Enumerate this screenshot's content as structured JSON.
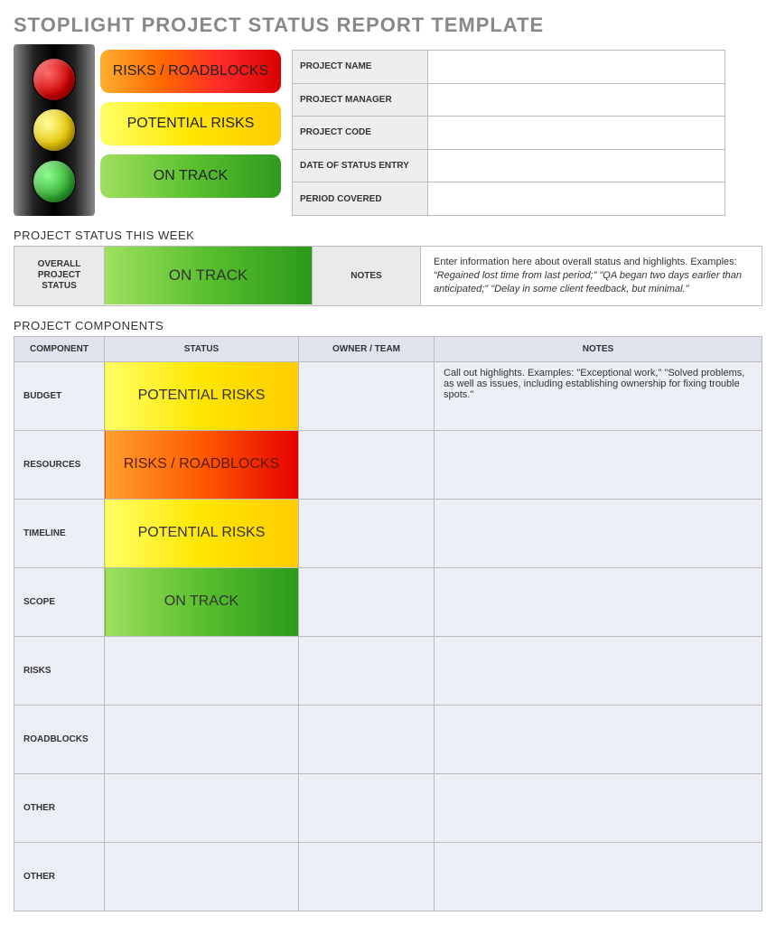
{
  "title": "STOPLIGHT PROJECT STATUS REPORT TEMPLATE",
  "legend": {
    "red": "RISKS / ROADBLOCKS",
    "yellow": "POTENTIAL RISKS",
    "green": "ON TRACK"
  },
  "meta": {
    "project_name_label": "PROJECT NAME",
    "project_name": "",
    "project_manager_label": "PROJECT MANAGER",
    "project_manager": "",
    "project_code_label": "PROJECT CODE",
    "project_code": "",
    "date_label": "DATE OF STATUS ENTRY",
    "date": "",
    "period_label": "PERIOD COVERED",
    "period": ""
  },
  "status_week": {
    "section_title": "PROJECT STATUS THIS WEEK",
    "overall_label_line1": "OVERALL",
    "overall_label_line2": "PROJECT",
    "overall_label_line3": "STATUS",
    "overall_value": "ON TRACK",
    "notes_label": "NOTES",
    "notes_intro": "Enter information here about overall status and highlights. Examples: ",
    "notes_examples": "“Regained lost time from last period;” \"QA began two days earlier than anticipated;\" \"Delay in some client feedback, but minimal.\""
  },
  "components": {
    "section_title": "PROJECT COMPONENTS",
    "headers": {
      "component": "COMPONENT",
      "status": "STATUS",
      "owner": "OWNER / TEAM",
      "notes": "NOTES"
    },
    "rows": [
      {
        "name": "BUDGET",
        "status_text": "POTENTIAL RISKS",
        "status_class": "stat-yellow",
        "owner": "",
        "notes": "Call out highlights. Examples: \"Exceptional work,\" \"Solved problems, as well as issues, including establishing ownership for fixing trouble spots.\""
      },
      {
        "name": "RESOURCES",
        "status_text": "RISKS / ROADBLOCKS",
        "status_class": "stat-red",
        "owner": "",
        "notes": ""
      },
      {
        "name": "TIMELINE",
        "status_text": "POTENTIAL RISKS",
        "status_class": "stat-yellow",
        "owner": "",
        "notes": ""
      },
      {
        "name": "SCOPE",
        "status_text": "ON TRACK",
        "status_class": "stat-green",
        "owner": "",
        "notes": ""
      },
      {
        "name": "RISKS",
        "status_text": "",
        "status_class": "",
        "owner": "",
        "notes": ""
      },
      {
        "name": "ROADBLOCKS",
        "status_text": "",
        "status_class": "",
        "owner": "",
        "notes": ""
      },
      {
        "name": "OTHER",
        "status_text": "",
        "status_class": "",
        "owner": "",
        "notes": ""
      },
      {
        "name": "OTHER",
        "status_text": "",
        "status_class": "",
        "owner": "",
        "notes": ""
      }
    ]
  }
}
